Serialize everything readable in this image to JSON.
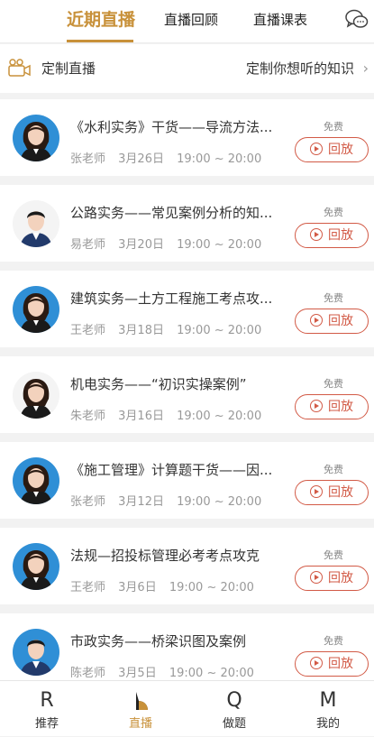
{
  "top_tabs": [
    {
      "label": "近期直播",
      "active": true
    },
    {
      "label": "直播回顾",
      "active": false
    },
    {
      "label": "直播课表",
      "active": false
    }
  ],
  "custom_live": {
    "left_label": "定制直播",
    "right_label": "定制你想听的知识",
    "icon": "video-camera-icon"
  },
  "lessons": [
    {
      "title": "《水利实务》干货——导流方法...",
      "teacher": "张老师",
      "date": "3月26日",
      "time": "19:00 ~ 20:00",
      "price": "免费",
      "action": "回放",
      "avatar": "female-teacher-blue"
    },
    {
      "title": "公路实务——常见案例分析的知...",
      "teacher": "易老师",
      "date": "3月20日",
      "time": "19:00 ~ 20:00",
      "price": "免费",
      "action": "回放",
      "avatar": "male-teacher-white"
    },
    {
      "title": "建筑实务—土方工程施工考点攻...",
      "teacher": "王老师",
      "date": "3月18日",
      "time": "19:00 ~ 20:00",
      "price": "免费",
      "action": "回放",
      "avatar": "female-teacher-blue"
    },
    {
      "title": "机电实务——“初识实操案例”",
      "teacher": "朱老师",
      "date": "3月16日",
      "time": "19:00 ~ 20:00",
      "price": "免费",
      "action": "回放",
      "avatar": "female-teacher-white"
    },
    {
      "title": "《施工管理》计算题干货——因...",
      "teacher": "张老师",
      "date": "3月12日",
      "time": "19:00 ~ 20:00",
      "price": "免费",
      "action": "回放",
      "avatar": "female-teacher-blue"
    },
    {
      "title": "法规—招投标管理必考考点攻克",
      "teacher": "王老师",
      "date": "3月6日",
      "time": "19:00 ~ 20:00",
      "price": "免费",
      "action": "回放",
      "avatar": "female-teacher-blue"
    },
    {
      "title": "市政实务——桥梁识图及案例",
      "teacher": "陈老师",
      "date": "3月5日",
      "time": "19:00 ~ 20:00",
      "price": "免费",
      "action": "回放",
      "avatar": "male-teacher-blue"
    }
  ],
  "bottom_nav": [
    {
      "glyph": "R",
      "label": "推荐",
      "active": false
    },
    {
      "glyph": "L",
      "label": "直播",
      "active": true
    },
    {
      "glyph": "Q",
      "label": "做题",
      "active": false
    },
    {
      "glyph": "M",
      "label": "我的",
      "active": false
    }
  ],
  "colors": {
    "accent": "#c8913a",
    "replay": "#d25a46"
  }
}
